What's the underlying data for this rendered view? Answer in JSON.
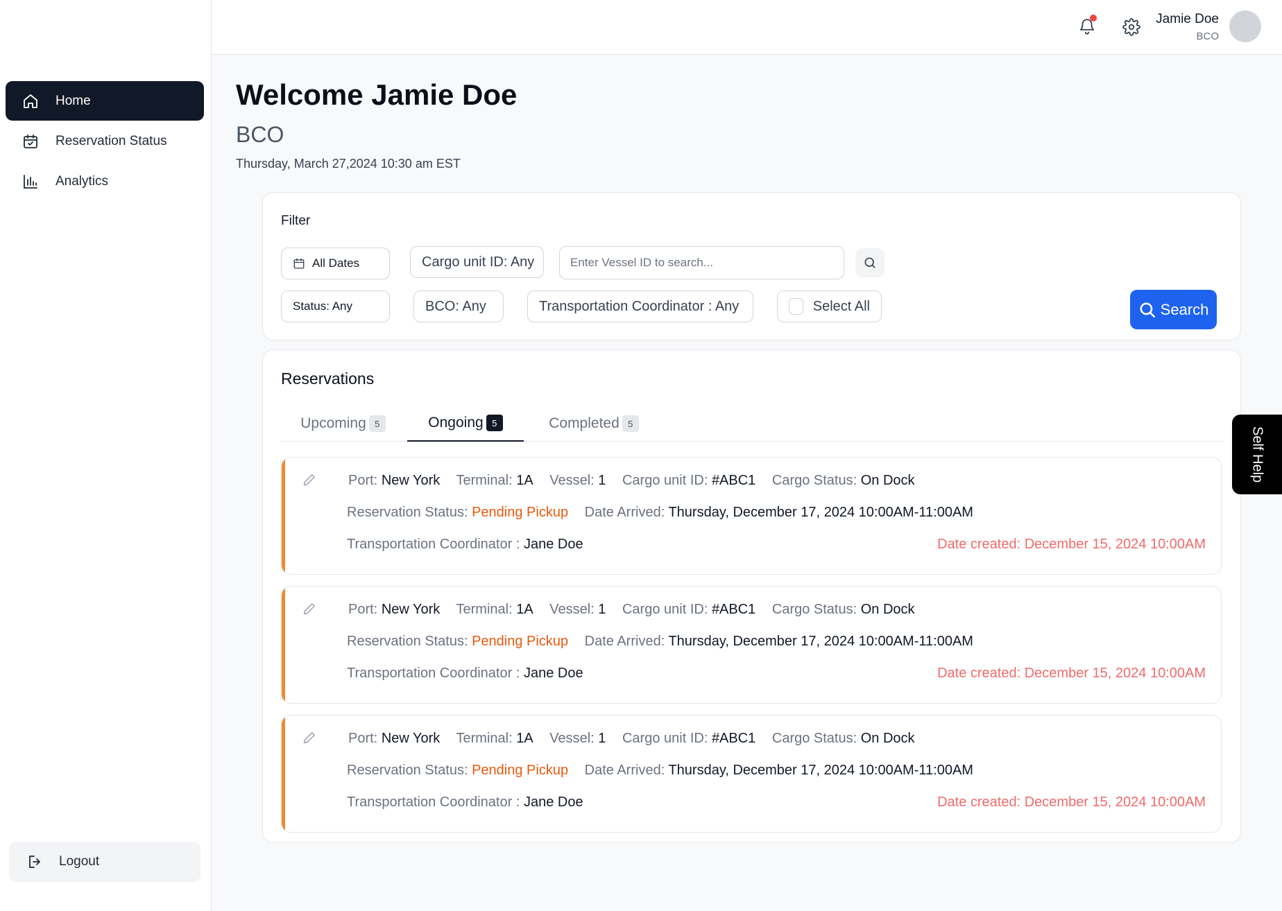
{
  "sidebar": {
    "items": [
      {
        "label": "Home",
        "icon": "home-icon",
        "active": true
      },
      {
        "label": "Reservation Status",
        "icon": "calendar-check-icon",
        "active": false
      },
      {
        "label": "Analytics",
        "icon": "bar-chart-icon",
        "active": false
      }
    ],
    "logout_label": "Logout"
  },
  "topbar": {
    "user_name": "Jamie Doe",
    "user_role": "BCO",
    "notification_dot_color": "#ef4444"
  },
  "header": {
    "welcome": "Welcome Jamie Doe",
    "role": "BCO",
    "datetime": "Thursday, March 27,2024 10:30 am EST"
  },
  "filter": {
    "title": "Filter",
    "all_dates": "All Dates",
    "cargo_unit": "Cargo unit ID: Any",
    "vessel_placeholder": "Enter Vessel ID to search...",
    "status": "Status: Any",
    "bco": "BCO: Any",
    "coordinator": "Transportation Coordinator : Any",
    "select_all": "Select All",
    "search_label": "Search",
    "accent_color": "#1d63f0"
  },
  "reservations": {
    "title": "Reservations",
    "tabs": [
      {
        "label": "Upcoming",
        "count": "5",
        "active": false
      },
      {
        "label": "Ongoing",
        "count": "5",
        "active": true
      },
      {
        "label": "Completed",
        "count": "5",
        "active": false
      }
    ],
    "labels": {
      "port": "Port:",
      "terminal": "Terminal:",
      "vessel": "Vessel:",
      "cargo_unit": "Cargo unit ID:",
      "cargo_status": "Cargo Status:",
      "reservation_status": "Reservation Status:",
      "date_arrived": "Date Arrived:",
      "coordinator": "Transportation Coordinator :"
    },
    "items": [
      {
        "port": "New York",
        "terminal": "1A",
        "vessel": "1",
        "cargo_unit": "#ABC1",
        "cargo_status": "On Dock",
        "reservation_status": "Pending Pickup",
        "date_arrived": "Thursday, December 17, 2024 10:00AM-11:00AM",
        "coordinator": "Jane Doe",
        "date_created": "Date created: December 15, 2024 10:00AM"
      },
      {
        "port": "New York",
        "terminal": "1A",
        "vessel": "1",
        "cargo_unit": "#ABC1",
        "cargo_status": "On Dock",
        "reservation_status": "Pending Pickup",
        "date_arrived": "Thursday, December 17, 2024 10:00AM-11:00AM",
        "coordinator": "Jane Doe",
        "date_created": "Date created: December 15, 2024 10:00AM"
      },
      {
        "port": "New York",
        "terminal": "1A",
        "vessel": "1",
        "cargo_unit": "#ABC1",
        "cargo_status": "On Dock",
        "reservation_status": "Pending Pickup",
        "date_arrived": "Thursday, December 17, 2024 10:00AM-11:00AM",
        "coordinator": "Jane Doe",
        "date_created": "Date created: December 15, 2024 10:00AM"
      }
    ],
    "accent_color": "#ee8a2f"
  },
  "self_help": {
    "label": "Self Help"
  }
}
